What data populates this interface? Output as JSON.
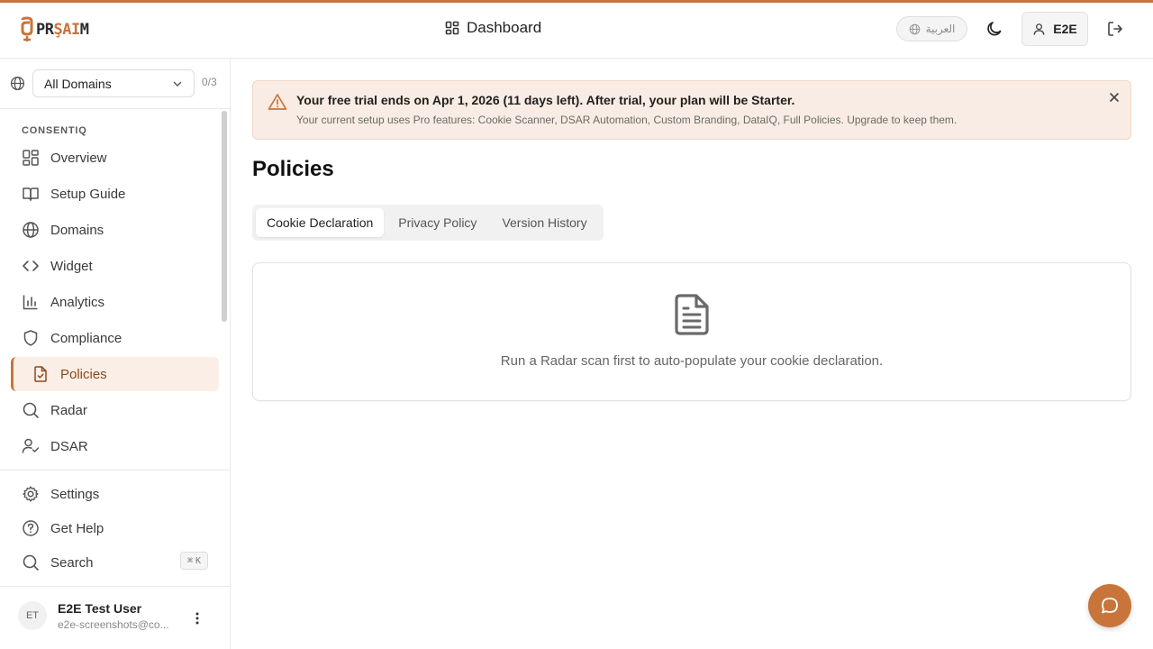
{
  "header": {
    "logo_text_a": "PR",
    "logo_text_b": "ŞAI",
    "logo_text_c": "M",
    "center_title": "Dashboard",
    "language_label": "العربية",
    "user_short": "E2E"
  },
  "sidebar": {
    "domain_select": "All Domains",
    "domain_count": "0/3",
    "section_label": "CONSENTIQ",
    "items": [
      {
        "label": "Overview"
      },
      {
        "label": "Setup Guide"
      },
      {
        "label": "Domains"
      },
      {
        "label": "Widget"
      },
      {
        "label": "Analytics"
      },
      {
        "label": "Compliance"
      },
      {
        "label": "Policies"
      },
      {
        "label": "Radar"
      },
      {
        "label": "DSAR"
      }
    ],
    "footer_items": [
      {
        "label": "Settings"
      },
      {
        "label": "Get Help"
      },
      {
        "label": "Search"
      }
    ],
    "search_shortcut_symbol": "⌘",
    "search_shortcut_key": "K",
    "user": {
      "initials": "ET",
      "name": "E2E Test User",
      "email": "e2e-screenshots@co..."
    }
  },
  "banner": {
    "title": "Your free trial ends on Apr 1, 2026 (11 days left). After trial, your plan will be Starter.",
    "subtitle": "Your current setup uses Pro features: Cookie Scanner, DSAR Automation, Custom Branding, DataIQ, Full Policies. Upgrade to keep them."
  },
  "main": {
    "page_title": "Policies",
    "tabs": [
      {
        "label": "Cookie Declaration"
      },
      {
        "label": "Privacy Policy"
      },
      {
        "label": "Version History"
      }
    ],
    "empty_state_text": "Run a Radar scan first to auto-populate your cookie declaration."
  },
  "colors": {
    "accent": "#c8743a",
    "active_bg": "#fbeee6",
    "banner_bg": "#f9ece4"
  },
  "icons": {
    "header_dashboard": "grid-icon",
    "language": "globe-icon",
    "theme": "moon-icon",
    "user": "user-icon",
    "logout": "logout-icon",
    "chat": "chat-bubble-icon"
  }
}
